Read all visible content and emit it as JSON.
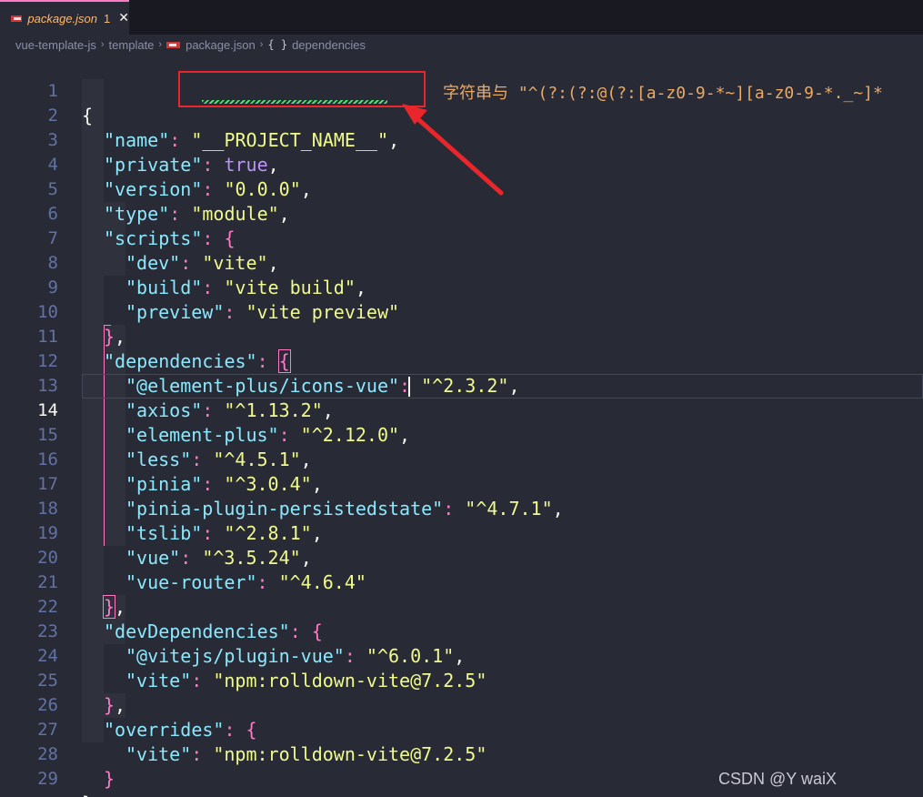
{
  "tab": {
    "file_icon": "npm-icon",
    "title": "package.json",
    "problem_count": "1",
    "close_symbol": "✕"
  },
  "breadcrumb": {
    "items": [
      "vue-template-js",
      "template",
      "package.json",
      "dependencies"
    ],
    "separator": "›",
    "symbol_icon": "{ }"
  },
  "editor": {
    "active_line": "14",
    "line_numbers": [
      "1",
      "2",
      "3",
      "4",
      "5",
      "6",
      "7",
      "8",
      "9",
      "10",
      "11",
      "12",
      "13",
      "14",
      "15",
      "16",
      "17",
      "18",
      "19",
      "20",
      "21",
      "22",
      "23",
      "24",
      "25",
      "26",
      "27",
      "28",
      "29"
    ],
    "lines": {
      "l1": {
        "open": "{"
      },
      "l2": {
        "key": "\"name\"",
        "colon": ": ",
        "value": "\"__PROJECT_NAME__\"",
        "comma": ","
      },
      "l3": {
        "key": "\"private\"",
        "colon": ": ",
        "value": "true",
        "comma": ","
      },
      "l4": {
        "key": "\"version\"",
        "colon": ": ",
        "value": "\"0.0.0\"",
        "comma": ","
      },
      "l5": {
        "key": "\"type\"",
        "colon": ": ",
        "value": "\"module\"",
        "comma": ","
      },
      "l6": {
        "key": "\"scripts\"",
        "colon": ": ",
        "brace": "{"
      },
      "l7": {
        "key": "\"dev\"",
        "colon": ": ",
        "value": "\"vite\"",
        "comma": ","
      },
      "l8": {
        "key": "\"build\"",
        "colon": ": ",
        "value": "\"vite build\"",
        "comma": ","
      },
      "l9": {
        "key": "\"preview\"",
        "colon": ": ",
        "value": "\"vite preview\""
      },
      "l10": {
        "brace": "}",
        "comma": ","
      },
      "l11": {
        "key": "\"dependencies\"",
        "colon": ": ",
        "brace": "{"
      },
      "l12": {
        "key": "\"@element-plus/icons-vue\"",
        "colon": ": ",
        "value": "\"^2.3.2\"",
        "comma": ","
      },
      "l13": {
        "key": "\"axios\"",
        "colon": ": ",
        "value": "\"^1.13.2\"",
        "comma": ","
      },
      "l14": {
        "key": "\"element-plus\"",
        "colon": ": ",
        "value": "\"^2.12.0\"",
        "comma": ","
      },
      "l15": {
        "key": "\"less\"",
        "colon": ": ",
        "value": "\"^4.5.1\"",
        "comma": ","
      },
      "l16": {
        "key": "\"pinia\"",
        "colon": ": ",
        "value": "\"^3.0.4\"",
        "comma": ","
      },
      "l17": {
        "key": "\"pinia-plugin-persistedstate\"",
        "colon": ": ",
        "value": "\"^4.7.1\"",
        "comma": ","
      },
      "l18": {
        "key": "\"tslib\"",
        "colon": ": ",
        "value": "\"^2.8.1\"",
        "comma": ","
      },
      "l19": {
        "key": "\"vue\"",
        "colon": ": ",
        "value": "\"^3.5.24\"",
        "comma": ","
      },
      "l20": {
        "key": "\"vue-router\"",
        "colon": ": ",
        "value": "\"^4.6.4\""
      },
      "l21": {
        "brace": "}",
        "comma": ","
      },
      "l22": {
        "key": "\"devDependencies\"",
        "colon": ": ",
        "brace": "{"
      },
      "l23": {
        "key": "\"@vitejs/plugin-vue\"",
        "colon": ": ",
        "value": "\"^6.0.1\"",
        "comma": ","
      },
      "l24": {
        "key": "\"vite\"",
        "colon": ": ",
        "value": "\"npm:rolldown-vite@7.2.5\""
      },
      "l25": {
        "brace": "}",
        "comma": ","
      },
      "l26": {
        "key": "\"overrides\"",
        "colon": ": ",
        "brace": "{"
      },
      "l27": {
        "key": "\"vite\"",
        "colon": ": ",
        "value": "\"npm:rolldown-vite@7.2.5\""
      },
      "l28": {
        "brace": "}"
      },
      "l29": {
        "close": "}"
      }
    },
    "inline_hint": "字符串与 \"^(?:(?:@(?:[a-z0-9-*~][a-z0-9-*._~]*"
  },
  "annotation": {
    "box_color": "#e8262b",
    "arrow_color": "#e8262b"
  },
  "watermark": "CSDN @Y waiX",
  "colors": {
    "background": "#282a36",
    "key": "#8be9fd",
    "string": "#f1fa8c",
    "boolean": "#bd93f9",
    "punctuation": "#ff79c6",
    "line_number": "#6272a4",
    "tab_accent": "#ff79c6",
    "tab_title": "#ffb86c"
  }
}
